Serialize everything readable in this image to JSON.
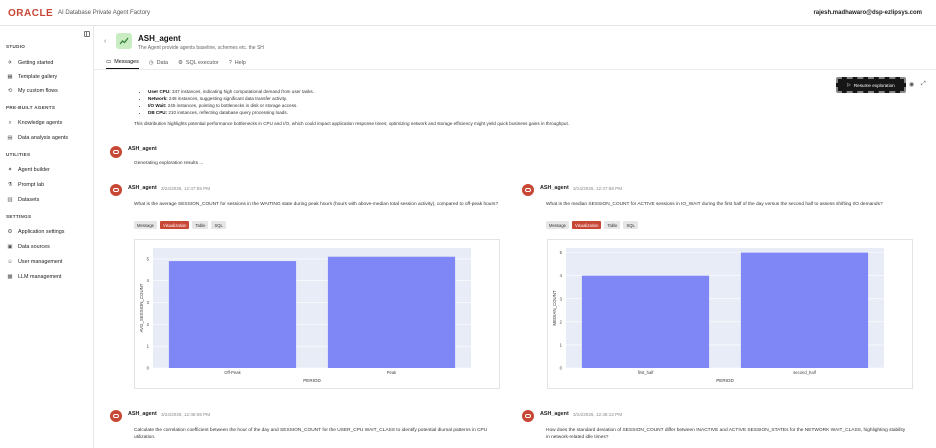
{
  "app": {
    "logo": "ORACLE",
    "subtitle": "AI Database Private Agent Factory",
    "user": "rajesh.madhawaro@dsp-ezlipsys.com"
  },
  "sidebar": {
    "sections": [
      {
        "title": "STUDIO",
        "items": [
          {
            "label": "Getting started",
            "icon": "rocket-icon",
            "glyph": "✈"
          },
          {
            "label": "Template gallery",
            "icon": "grid-icon",
            "glyph": "▦"
          },
          {
            "label": "My custom flows",
            "icon": "flow-icon",
            "glyph": "⟲"
          }
        ]
      },
      {
        "title": "PRE-BUILT AGENTS",
        "items": [
          {
            "label": "Knowledge agents",
            "icon": "search-icon",
            "glyph": "⌕"
          },
          {
            "label": "Data analysis agents",
            "icon": "chart-icon",
            "glyph": "▤"
          }
        ]
      },
      {
        "title": "UTILITIES",
        "items": [
          {
            "label": "Agent builder",
            "icon": "wand-icon",
            "glyph": "✦"
          },
          {
            "label": "Prompt lab",
            "icon": "flask-icon",
            "glyph": "⚗"
          },
          {
            "label": "Datasets",
            "icon": "database-icon",
            "glyph": "▥"
          }
        ]
      },
      {
        "title": "SETTINGS",
        "items": [
          {
            "label": "Application settings",
            "icon": "gear-icon",
            "glyph": "⚙"
          },
          {
            "label": "Data sources",
            "icon": "datasource-icon",
            "glyph": "▣"
          },
          {
            "label": "User management",
            "icon": "user-icon",
            "glyph": "☺"
          },
          {
            "label": "LLM management",
            "icon": "chip-icon",
            "glyph": "▩"
          }
        ]
      }
    ]
  },
  "agent": {
    "name": "ASH_agent",
    "description": "The Agent provide agents baseline, schemes etc. the SH",
    "tabs": [
      {
        "label": "Messages",
        "icon": "chat-icon",
        "glyph": "▭",
        "active": true
      },
      {
        "label": "Data",
        "icon": "clock-icon",
        "glyph": "◷",
        "active": false
      },
      {
        "label": "SQL executor",
        "icon": "settings-icon",
        "glyph": "⚙",
        "active": false
      },
      {
        "label": "Help",
        "icon": "help-icon",
        "glyph": "?",
        "active": false
      }
    ]
  },
  "toolbar": {
    "resume_label": "Resume exploration"
  },
  "intro": {
    "bullets": [
      {
        "bold": "User CPU:",
        "text": " 347 instances, indicating high computational demand from user tasks."
      },
      {
        "bold": "Network:",
        "text": " 248 instances, suggesting significant data transfer activity."
      },
      {
        "bold": "I/O Wait:",
        "text": " 245 instances, pointing to bottlenecks in disk or storage access."
      },
      {
        "bold": "DB CPU:",
        "text": " 210 instances, reflecting database query processing loads."
      }
    ],
    "summary": "This distribution highlights potential performance bottlenecks in CPU and I/O, which could impact application response times; optimizing network and storage efficiency might yield quick business gains in throughput."
  },
  "status_message": {
    "name": "ASH_agent",
    "text": "Generating exploration results ..."
  },
  "pill_labels": [
    "Message",
    "Visualization",
    "Table",
    "SQL"
  ],
  "messages": [
    {
      "name": "ASH_agent",
      "time": "3/24/2026, 12:47:55 PM",
      "text": "What is the average SESSION_COUNT for sessions in the WAITING state during peak hours (hours with above-median total session activity), compared to off-peak hours?"
    },
    {
      "name": "ASH_agent",
      "time": "3/24/2026, 12:47:58 PM",
      "text": "What is the median SESSION_COUNT for ACTIVE sessions in IO_WAIT during the first half of the day versus the second half to assess shifting I/O demands?"
    },
    {
      "name": "ASH_agent",
      "time": "3/24/2026, 12:48:06 PM",
      "text": "Calculate the correlation coefficient between the hour of the day and SESSION_COUNT for the USER_CPU WAIT_CLASS to identify potential diurnal patterns in CPU utilization."
    },
    {
      "name": "ASH_agent",
      "time": "3/24/2026, 12:48:12 PM",
      "text": "How does the standard deviation of SESSION_COUNT differ between INACTIVE and ACTIVE SESSION_STATEs for the NETWORK WAIT_CLASS, highlighting stability in network-related idle times?"
    }
  ],
  "colors": {
    "accent": "#c74634",
    "bar": "#7f86f5",
    "plot_bg": "#e8ecf6"
  },
  "chart_data": [
    {
      "type": "bar",
      "categories": [
        "Off-Peak",
        "Peak"
      ],
      "values": [
        4.9,
        5.1
      ],
      "xlabel": "PERIOD",
      "ylabel": "AVG_SESSION_COUNT",
      "yticks": [
        0,
        1,
        2,
        3,
        4,
        5
      ],
      "ylim": [
        0,
        5.5
      ]
    },
    {
      "type": "bar",
      "categories": [
        "first_half",
        "second_half"
      ],
      "values": [
        4,
        5
      ],
      "xlabel": "PERIOD",
      "ylabel": "MEDIAN_COUNT",
      "yticks": [
        0,
        1,
        2,
        3,
        4,
        5
      ],
      "ylim": [
        0,
        5.2
      ]
    }
  ]
}
